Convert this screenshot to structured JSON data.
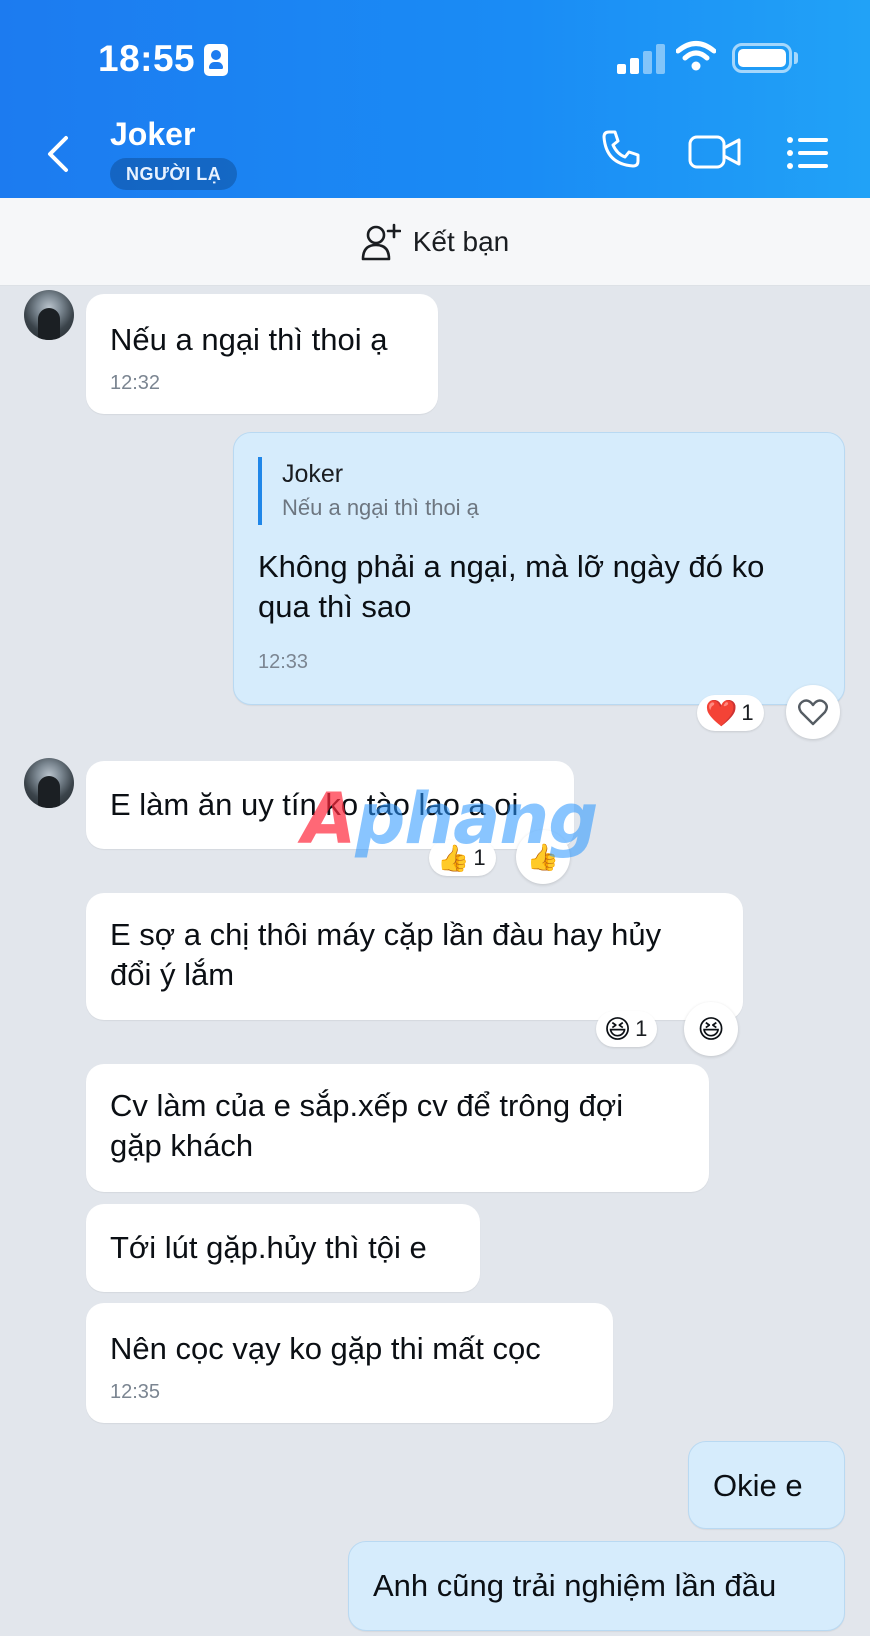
{
  "status_bar": {
    "time": "18:55"
  },
  "header": {
    "contact_name": "Joker",
    "badge": "NGƯỜI LẠ",
    "colors": {
      "bg_start": "#1c7bf0",
      "bg_end": "#21a2f7"
    }
  },
  "friend_bar": {
    "label": "Kết bạn",
    "icon": "add-friend-icon"
  },
  "messages": [
    {
      "side": "left",
      "text": "Nếu a ngại thì thoi ạ",
      "time": "12:32"
    },
    {
      "side": "right",
      "quote_name": "Joker",
      "quote_text": "Nếu a ngại thì thoi ạ",
      "text_line1": "Không phải a ngại, mà lỡ ngày đó ko",
      "text_line2": "qua thì sao",
      "time": "12:33",
      "reaction": "❤️",
      "reaction_count": "1"
    },
    {
      "side": "left",
      "text": "E làm ăn uy tín ko tào lao a oi",
      "reaction": "👍",
      "reaction_count": "1"
    },
    {
      "side": "left",
      "text_line1": "E sợ a chị thôi máy cặp lần đàu hay hủy",
      "text_line2": "đổi ý lắm",
      "reaction": "😆",
      "reaction_count": "1"
    },
    {
      "side": "left",
      "text_line1": "Cv làm của e sắp.xếp cv để trông đợi",
      "text_line2": "gặp khách"
    },
    {
      "side": "left",
      "text": "Tới lút gặp.hủy thì tội e"
    },
    {
      "side": "left",
      "text": "Nên cọc vạy ko gặp thi mất cọc",
      "time": "12:35"
    },
    {
      "side": "right",
      "text": "Okie e"
    },
    {
      "side": "right",
      "text": "Anh cũng trải nghiệm lần đầu"
    }
  ],
  "watermark": {
    "part1": "A",
    "part2": "phang"
  }
}
